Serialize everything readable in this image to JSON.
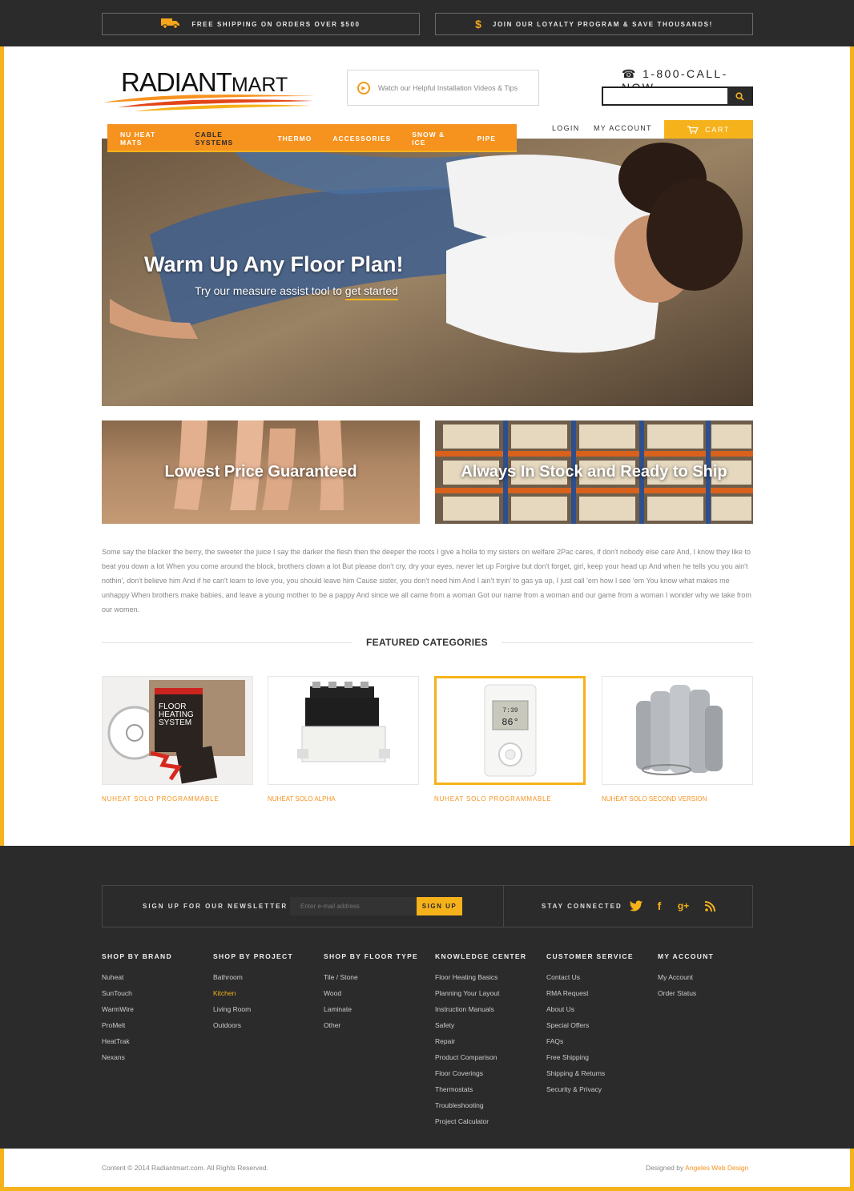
{
  "promos": {
    "shipping": {
      "icon": "truck-icon",
      "text": "FREE SHIPPING ON ORDERS OVER $500"
    },
    "loyalty": {
      "icon": "dollar-icon",
      "text": "JOIN OUR LOYALTY PROGRAM & SAVE THOUSANDS!"
    }
  },
  "logo": {
    "part1": "RADIANT",
    "part2": "MART"
  },
  "video_link": "Watch our Helpful Installation Videos & Tips",
  "phone": "☎ 1-800-CALL-NOW",
  "search": {
    "placeholder": ""
  },
  "account": {
    "login": "LOGIN",
    "my_account": "MY ACCOUNT",
    "cart": "CART"
  },
  "nav": [
    "NU HEAT MATS",
    "CABLE SYSTEMS",
    "THERMO",
    "ACCESSORIES",
    "SNOW & ICE",
    "PIPE"
  ],
  "hero": {
    "title": "Warm Up Any Floor Plan!",
    "subtitle_pre": "Try our measure assist tool to ",
    "subtitle_link": "get started"
  },
  "tiles": [
    "Lowest Price Guaranteed",
    "Always In Stock and Ready to Ship"
  ],
  "body_text": "Some say the blacker the berry, the sweeter the juice I say the darker the flesh then the deeper the roots I give a holla to my sisters on welfare 2Pac cares, if don't nobody else care And, I know they like to beat you down a lot When you come around the block, brothers clown a lot But please don't cry, dry your eyes, never let up Forgive but don't forget, girl, keep your head up And when he tells you you ain't nothin', don't believe him And if he can't learn to love you, you should leave him Cause sister, you don't need him And I ain't tryin' to gas ya up, I just call 'em how I see 'em You know what makes me unhappy When brothers make babies, and leave a young mother to be a pappy And since we all came from a woman Got our name from a woman and our game from a woman I wonder why we take from our women.",
  "featured_title": "FEATURED CATEGORIES",
  "products": [
    {
      "name": "NUHEAT SOLO PROGRAMMABLE"
    },
    {
      "name": "NUHEAT SOLO ALPHA"
    },
    {
      "name": "NUHEAT SOLO PROGRAMMABLE"
    },
    {
      "name": "NUHEAT SOLO SECOND VERSION"
    }
  ],
  "box_texts": {
    "floor1": "FLOOR",
    "floor2": "HEATING",
    "floor3": "SYSTEM",
    "thermo_time": "7:39",
    "thermo_temp": "86°"
  },
  "newsletter": {
    "label": "SIGN UP FOR OUR NEWSLETTER",
    "placeholder": "Enter e-mail address",
    "button": "SIGN UP",
    "stay": "STAY CONNECTED"
  },
  "footer_cols": [
    {
      "title": "SHOP BY BRAND",
      "items": [
        "Nuheat",
        "SunTouch",
        "WarmWire",
        "ProMelt",
        "HeatTrak",
        "Nexans"
      ]
    },
    {
      "title": "SHOP BY PROJECT",
      "items": [
        "Bathroom",
        "Kitchen",
        "Living Room",
        "Outdoors"
      ]
    },
    {
      "title": "SHOP BY FLOOR TYPE",
      "items": [
        "Tile / Stone",
        "Wood",
        "Laminate",
        "Other"
      ]
    },
    {
      "title": "KNOWLEDGE CENTER",
      "items": [
        "Floor Heating Basics",
        "Planning Your Layout",
        "Instruction Manuals",
        "Safety",
        "Repair",
        "Product Comparison",
        "Floor Coverings",
        "Thermostats",
        "Troubleshooting",
        "Project Calculator"
      ]
    },
    {
      "title": "CUSTOMER SERVICE",
      "items": [
        "Contact Us",
        "RMA Request",
        "About Us",
        "Special Offers",
        "FAQs",
        "Free Shipping",
        "Shipping & Returns",
        "Security & Privacy"
      ]
    },
    {
      "title": "MY ACCOUNT",
      "items": [
        "My Account",
        "Order Status"
      ]
    }
  ],
  "copyright": "Content © 2014 Radiantmart.com. All Rights Reserved.",
  "credit": {
    "pre": "Designed by ",
    "name": "Angeles Web Design"
  },
  "colors": {
    "accent": "#f6b21b",
    "orange": "#f6921e",
    "dark": "#2b2b2b"
  }
}
